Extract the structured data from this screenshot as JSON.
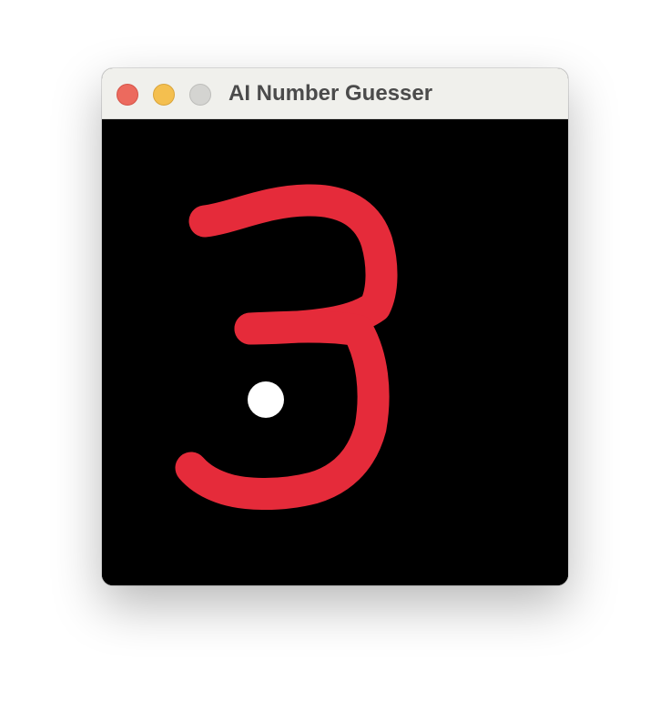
{
  "window": {
    "title": "AI Number Guesser",
    "canvas_background_color": "#000000",
    "stroke_color": "#e52b3a",
    "cursor_color": "#ffffff"
  },
  "titlebar": {
    "buttons": [
      {
        "name": "close",
        "color": "#ec6a5e"
      },
      {
        "name": "minimize",
        "color": "#f4bf4f"
      },
      {
        "name": "zoom",
        "color": "#d4d4d1"
      }
    ]
  }
}
